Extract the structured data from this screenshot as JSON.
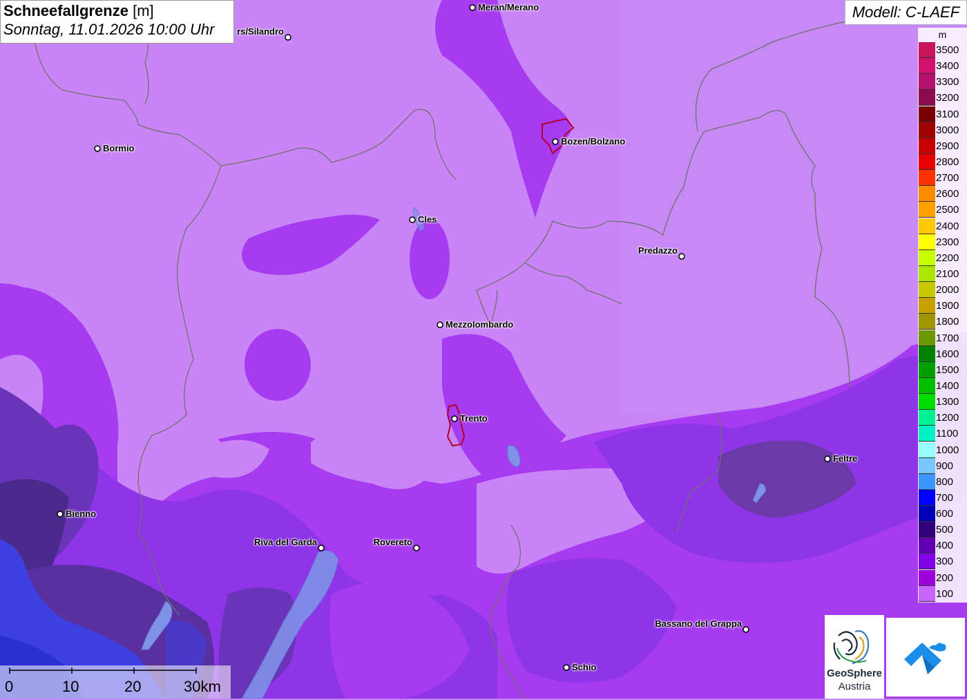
{
  "title": {
    "parameter": "Schneefallgrenze",
    "unit": "[m]",
    "datetime": "Sonntag, 11.01.2026 10:00 Uhr"
  },
  "model": "Modell: C-LAEF",
  "legend": {
    "unit": "m",
    "levels": [
      {
        "value": "3500",
        "color": "#c8145a"
      },
      {
        "value": "3400",
        "color": "#d0126e"
      },
      {
        "value": "3300",
        "color": "#b4106e"
      },
      {
        "value": "3200",
        "color": "#8c0a50"
      },
      {
        "value": "3100",
        "color": "#7a0000"
      },
      {
        "value": "3000",
        "color": "#a00000"
      },
      {
        "value": "2900",
        "color": "#c80000"
      },
      {
        "value": "2800",
        "color": "#e60000"
      },
      {
        "value": "2700",
        "color": "#ff3200"
      },
      {
        "value": "2600",
        "color": "#ff8c00"
      },
      {
        "value": "2500",
        "color": "#ffa000"
      },
      {
        "value": "2400",
        "color": "#ffc800"
      },
      {
        "value": "2300",
        "color": "#ffff00"
      },
      {
        "value": "2200",
        "color": "#c8ff00"
      },
      {
        "value": "2100",
        "color": "#aae600"
      },
      {
        "value": "2000",
        "color": "#c8c800"
      },
      {
        "value": "1900",
        "color": "#c8a000"
      },
      {
        "value": "1800",
        "color": "#a09600"
      },
      {
        "value": "1700",
        "color": "#6e9600"
      },
      {
        "value": "1600",
        "color": "#008200"
      },
      {
        "value": "1500",
        "color": "#00a000"
      },
      {
        "value": "1400",
        "color": "#00be00"
      },
      {
        "value": "1300",
        "color": "#00dc00"
      },
      {
        "value": "1200",
        "color": "#00f096"
      },
      {
        "value": "1100",
        "color": "#00f0c8"
      },
      {
        "value": "1000",
        "color": "#96ffff"
      },
      {
        "value": "900",
        "color": "#78c8ff"
      },
      {
        "value": "800",
        "color": "#3c96ff"
      },
      {
        "value": "700",
        "color": "#0000ff"
      },
      {
        "value": "600",
        "color": "#0000b4"
      },
      {
        "value": "500",
        "color": "#32007a"
      },
      {
        "value": "400",
        "color": "#6400b4"
      },
      {
        "value": "300",
        "color": "#8200e6"
      },
      {
        "value": "200",
        "color": "#a000dc"
      },
      {
        "value": "100",
        "color": "#c864ff"
      }
    ]
  },
  "cities": [
    {
      "name": "Meran/Merano",
      "label_side": "right"
    },
    {
      "name": "rs/Silandro",
      "label_side": "left"
    },
    {
      "name": "Bormio",
      "label_side": "right"
    },
    {
      "name": "Bozen/Bolzano",
      "label_side": "right"
    },
    {
      "name": "Cles",
      "label_side": "right"
    },
    {
      "name": "Predazzo",
      "label_side": "left"
    },
    {
      "name": "Mezzolombardo",
      "label_side": "right"
    },
    {
      "name": "Trento",
      "label_side": "right"
    },
    {
      "name": "Feltre",
      "label_side": "right"
    },
    {
      "name": "Bienno",
      "label_side": "right"
    },
    {
      "name": "Riva del Garda",
      "label_side": "left"
    },
    {
      "name": "Rovereto",
      "label_side": "left"
    },
    {
      "name": "Bassano del Grappa",
      "label_side": "left"
    },
    {
      "name": "Schio",
      "label_side": "right"
    }
  ],
  "scale_bar": {
    "labels": [
      "0",
      "10",
      "20",
      "30km"
    ]
  },
  "logos": {
    "geosphere_line1": "GeoSphere",
    "geosphere_line2": "Austria"
  }
}
